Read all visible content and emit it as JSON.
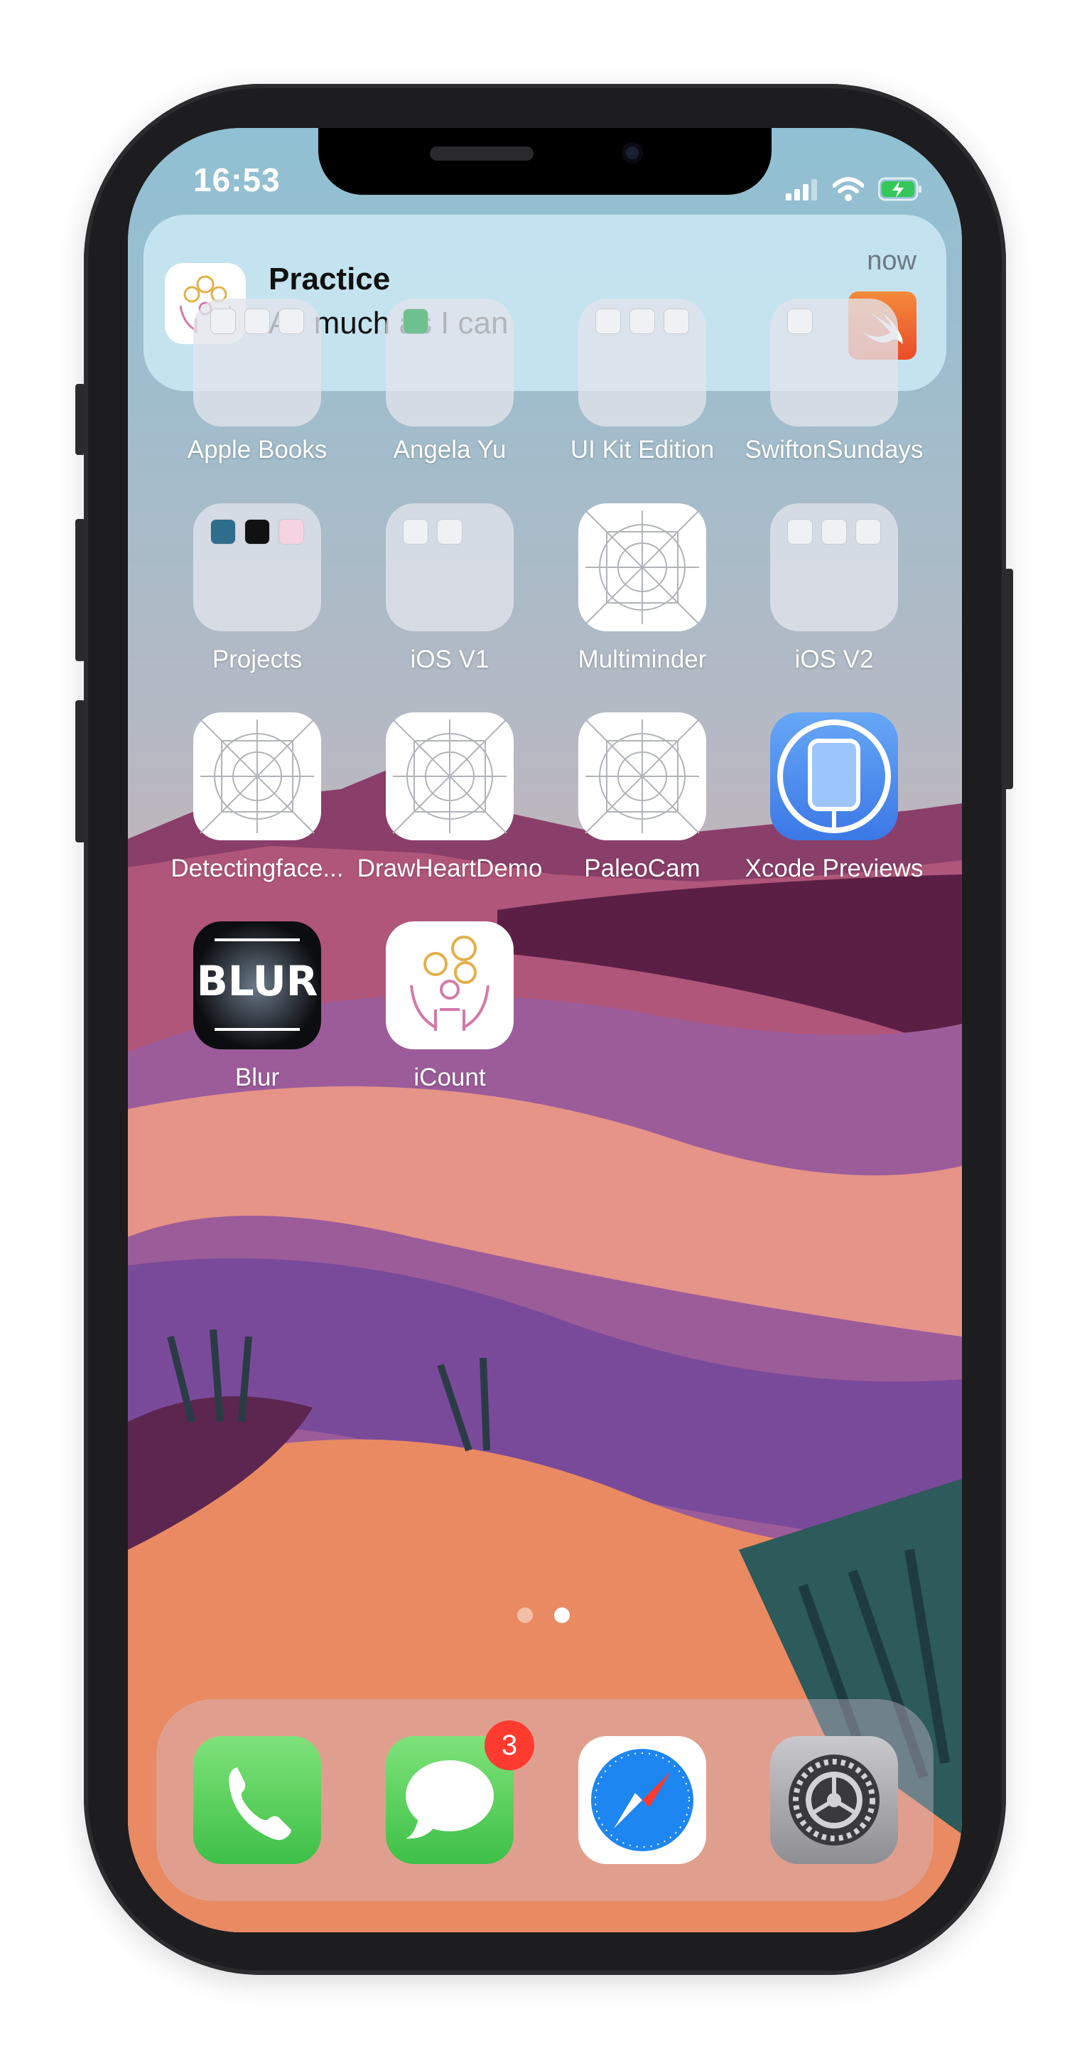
{
  "status_bar": {
    "time": "16:53",
    "icons": [
      "cellular-signal-icon",
      "wifi-icon",
      "battery-charging-icon"
    ]
  },
  "notification": {
    "app_icon": "icount-app-icon",
    "title": "Practice",
    "body": "As much as I can",
    "time": "now",
    "attachment_icon": "swift-icon"
  },
  "apps": [
    {
      "label": "Apple Books",
      "kind": "folder"
    },
    {
      "label": "Angela Yu",
      "kind": "folder"
    },
    {
      "label": "UI Kit Edition",
      "kind": "folder"
    },
    {
      "label": "SwiftonSundays",
      "kind": "folder"
    },
    {
      "label": "Projects",
      "kind": "folder"
    },
    {
      "label": "iOS V1",
      "kind": "folder"
    },
    {
      "label": "Multiminder",
      "kind": "placeholder-app"
    },
    {
      "label": "iOS V2",
      "kind": "folder"
    },
    {
      "label": "Detectingface...",
      "kind": "placeholder-app"
    },
    {
      "label": "DrawHeartDemo",
      "kind": "placeholder-app"
    },
    {
      "label": "PaleoCam",
      "kind": "placeholder-app"
    },
    {
      "label": "Xcode Previews",
      "kind": "app"
    },
    {
      "label": "Blur",
      "kind": "app",
      "icon_text": "BLUR"
    },
    {
      "label": "iCount",
      "kind": "app"
    }
  ],
  "page_indicator": {
    "pages": 2,
    "current": 2
  },
  "dock": [
    {
      "name": "phone-icon"
    },
    {
      "name": "messages-icon",
      "badge": "3"
    },
    {
      "name": "safari-icon"
    },
    {
      "name": "settings-icon"
    }
  ],
  "colors": {
    "notification_bg": "#c8e6f2",
    "badge": "#ff3b30",
    "phone_green": "#5ad35f",
    "safari_blue": "#1e86f0",
    "xcode_blue": "#4a8cf0"
  }
}
